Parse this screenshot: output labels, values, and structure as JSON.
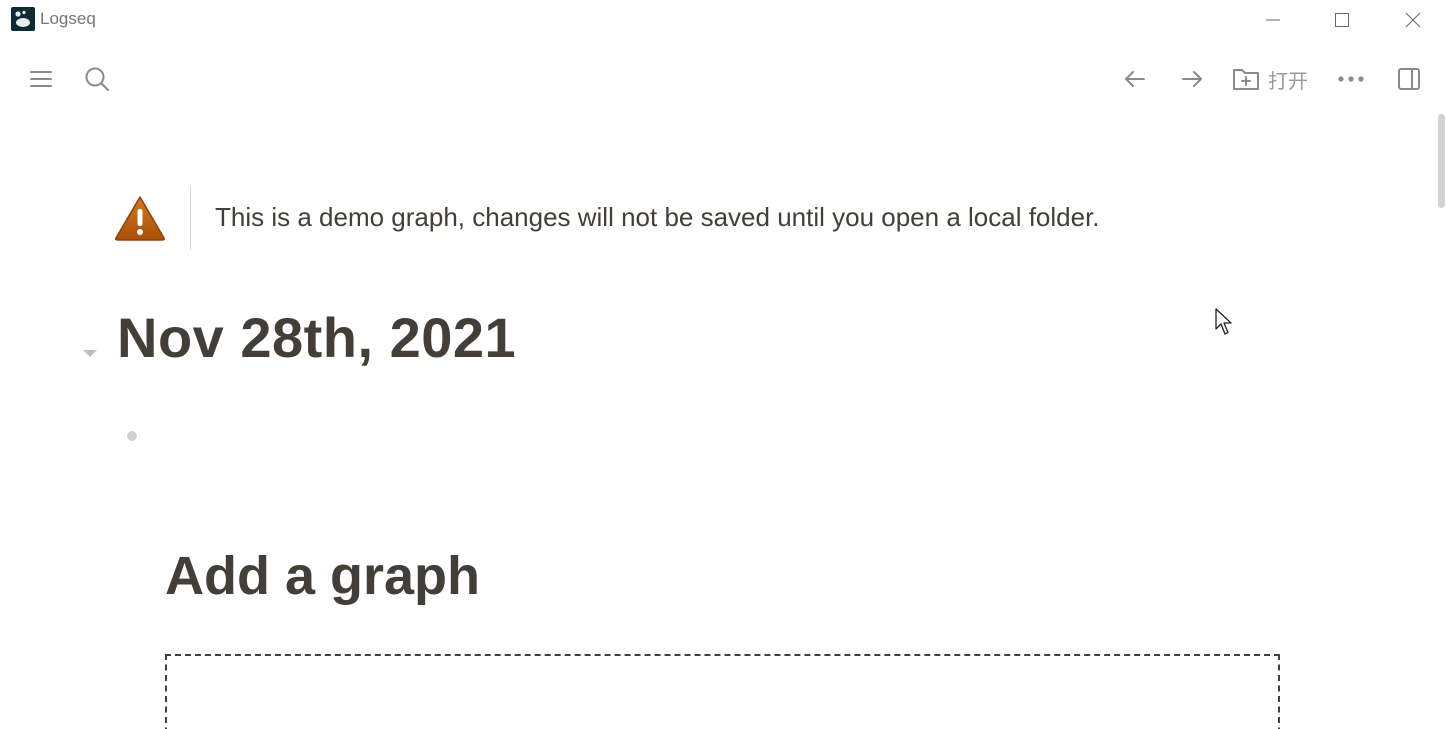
{
  "window": {
    "title": "Logseq"
  },
  "toolbar": {
    "open_label": "打开"
  },
  "notice": {
    "text": "This is a demo graph, changes will not be saved until you open a local folder.",
    "icon": "warning-icon",
    "color": "#b35a0c"
  },
  "journal": {
    "title": "Nov 28th, 2021"
  },
  "add_graph": {
    "title": "Add a graph"
  },
  "colors": {
    "text": "#433f38",
    "icon": "#8a8a8a"
  }
}
